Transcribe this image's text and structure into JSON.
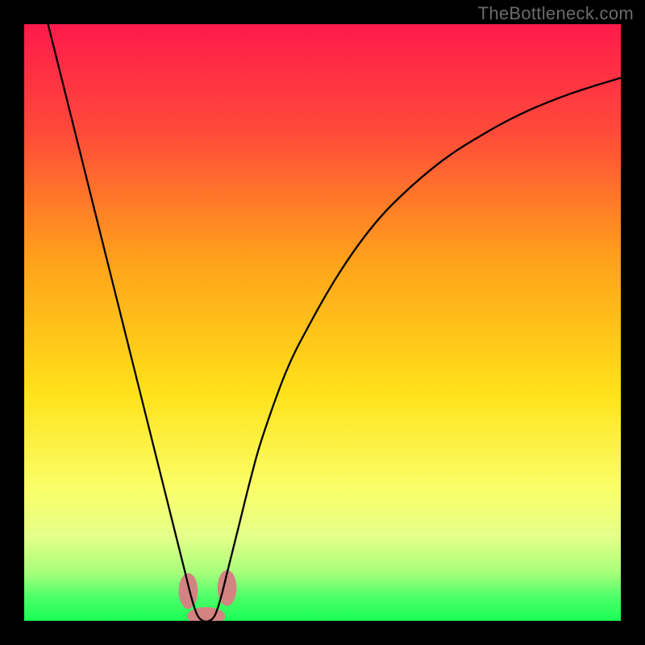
{
  "watermark": "TheBottleneck.com",
  "chart_data": {
    "type": "line",
    "title": "",
    "xlabel": "",
    "ylabel": "",
    "xlim": [
      0,
      100
    ],
    "ylim": [
      0,
      100
    ],
    "grid": false,
    "legend": null,
    "gradient_stops": [
      {
        "pct": 0,
        "color": "#ff1a4b"
      },
      {
        "pct": 18,
        "color": "#ff4a3a"
      },
      {
        "pct": 40,
        "color": "#ffa31a"
      },
      {
        "pct": 62,
        "color": "#ffe21a"
      },
      {
        "pct": 78,
        "color": "#faff6a"
      },
      {
        "pct": 86,
        "color": "#e4ff8a"
      },
      {
        "pct": 92,
        "color": "#a6ff7a"
      },
      {
        "pct": 96,
        "color": "#4dff6a"
      },
      {
        "pct": 100,
        "color": "#1aff55"
      }
    ],
    "series": [
      {
        "name": "bottleneck-curve",
        "stroke": "#000000",
        "stroke_width": 2.3,
        "x": [
          4,
          6,
          8,
          10,
          12,
          14,
          16,
          18,
          20,
          22,
          24,
          26,
          27,
          28,
          29,
          30,
          31,
          32,
          33,
          34,
          36,
          38,
          40,
          44,
          48,
          52,
          56,
          60,
          64,
          68,
          72,
          76,
          80,
          84,
          88,
          92,
          96,
          100
        ],
        "y": [
          100,
          92,
          84,
          76,
          68,
          60,
          52,
          44,
          36,
          28,
          20,
          12,
          8,
          4,
          1,
          0,
          0,
          1,
          4,
          8,
          16,
          24,
          31,
          42,
          50,
          57,
          63,
          68,
          72,
          75.5,
          78.5,
          81,
          83.3,
          85.3,
          87,
          88.5,
          89.8,
          91
        ]
      }
    ],
    "markers": [
      {
        "name": "min-region-left",
        "shape": "oval",
        "cx": 27.5,
        "cy": 5.0,
        "rx": 1.6,
        "ry": 3.0,
        "fill": "#d38381"
      },
      {
        "name": "min-region-bottom",
        "shape": "oval",
        "cx": 30.5,
        "cy": 0.8,
        "rx": 3.2,
        "ry": 1.5,
        "fill": "#d38381"
      },
      {
        "name": "min-region-right",
        "shape": "oval",
        "cx": 34.0,
        "cy": 5.5,
        "rx": 1.6,
        "ry": 3.0,
        "fill": "#d38381"
      }
    ]
  }
}
